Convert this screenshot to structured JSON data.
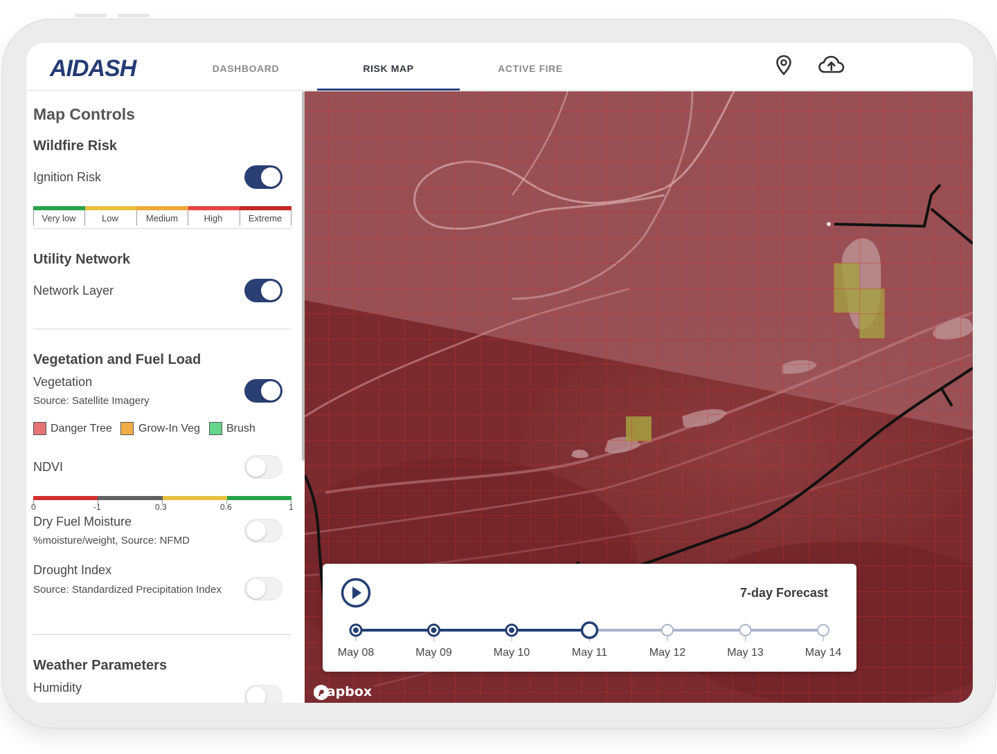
{
  "app": {
    "logo_text": "AIDASH"
  },
  "nav": {
    "tabs": [
      {
        "label": "DASHBOARD"
      },
      {
        "label": "RISK MAP"
      },
      {
        "label": "ACTIVE FIRE"
      }
    ],
    "active_tab": "RISK MAP",
    "icons": [
      "location-pin-icon",
      "cloud-upload-icon"
    ]
  },
  "sidebar": {
    "title": "Map Controls",
    "wildfire": {
      "title": "Wildfire Risk",
      "ignition_label": "Ignition Risk",
      "ignition_on": true,
      "scale": [
        "Very low",
        "Low",
        "Medium",
        "High",
        "Extreme"
      ],
      "scale_colors": [
        "#27a34a",
        "#e8c040",
        "#eda93a",
        "#e64545",
        "#c62828"
      ]
    },
    "utility": {
      "title": "Utility Network",
      "network_label": "Network Layer",
      "network_on": true
    },
    "vegetation": {
      "title": "Vegetation and Fuel Load",
      "veg_label": "Vegetation",
      "veg_source": "Source: Satellite Imagery",
      "veg_on": true,
      "legend": [
        {
          "label": "Danger Tree",
          "color": "#e57373"
        },
        {
          "label": "Grow-In Veg",
          "color": "#f0ac45"
        },
        {
          "label": "Brush",
          "color": "#66d68c"
        }
      ],
      "ndvi_label": "NDVI",
      "ndvi_on": false,
      "ndvi_ticks": [
        "0",
        "-1",
        "0.3",
        "0.6",
        "1"
      ],
      "ndvi_colors": [
        "#d32f2f",
        "#616161",
        "#e8c040",
        "#27a34a"
      ],
      "dry_fuel_label": "Dry Fuel Moisture",
      "dry_fuel_source": "%moisture/weight, Source: NFMD",
      "dry_fuel_on": false,
      "drought_label": "Drought Index",
      "drought_source": "Source: Standardized Precipitation Index",
      "drought_on": false
    },
    "weather": {
      "title": "Weather Parameters",
      "humidity_label": "Humidity",
      "humidity_on": false
    }
  },
  "map": {
    "attribution": "mapbox",
    "overlay_color": "#8b2a2e",
    "network_line_color": "#111111"
  },
  "forecast": {
    "title": "7-day Forecast",
    "days": [
      "May 08",
      "May 09",
      "May 10",
      "May 11",
      "May 12",
      "May 13",
      "May 14"
    ],
    "selected_index": 3,
    "accent": "#233e73",
    "inactive": "#a9b4ca"
  }
}
